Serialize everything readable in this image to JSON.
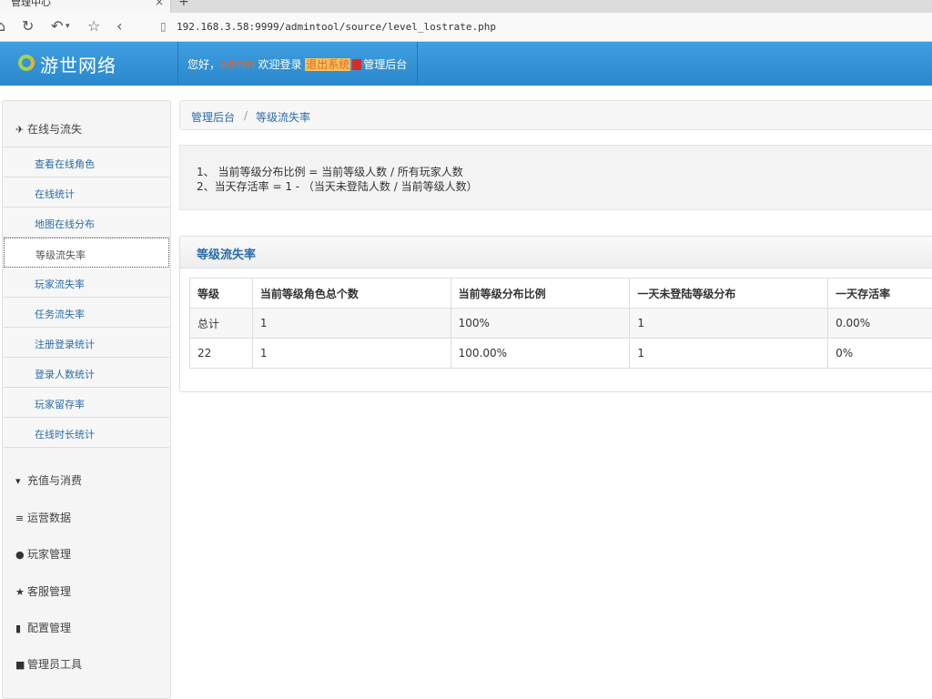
{
  "browser": {
    "tab_title": "管理中心",
    "tab_close": "×",
    "new_tab": "+",
    "url": "192.168.3.58:9999/admintool/source/level_lostrate.php"
  },
  "header": {
    "logo_text": "游世网络",
    "greeting_prefix": "您好，",
    "user": "admin",
    "welcome": " 欢迎登录 ",
    "logout": "退出系统",
    "admin_link": "管理后台"
  },
  "sidebar": {
    "groups": [
      {
        "label": "在线与流失",
        "icon": "plane-icon"
      },
      {
        "label": "充值与消费",
        "icon": "cart-icon"
      },
      {
        "label": "运营数据",
        "icon": "list-icon"
      },
      {
        "label": "玩家管理",
        "icon": "user-icon"
      },
      {
        "label": "客服管理",
        "icon": "star-icon"
      },
      {
        "label": "配置管理",
        "icon": "book-icon"
      },
      {
        "label": "管理员工具",
        "icon": "lock-icon"
      }
    ],
    "items": [
      {
        "label": "查看在线角色"
      },
      {
        "label": "在线统计"
      },
      {
        "label": "地图在线分布"
      },
      {
        "label": "等级流失率"
      },
      {
        "label": "玩家流失率"
      },
      {
        "label": "任务流失率"
      },
      {
        "label": "注册登录统计"
      },
      {
        "label": "登录人数统计"
      },
      {
        "label": "玩家留存率"
      },
      {
        "label": "在线时长统计"
      }
    ]
  },
  "breadcrumb": {
    "root": "管理后台",
    "sep": "/",
    "current": "等级流失率"
  },
  "info": {
    "line1": "1、 当前等级分布比例 = 当前等级人数 / 所有玩家人数",
    "line2": "2、当天存活率 = 1 - （当天未登陆人数 / 当前等级人数）"
  },
  "panel": {
    "title": "等级流失率"
  },
  "table": {
    "headers": [
      "等级",
      "当前等级角色总个数",
      "当前等级分布比例",
      "一天未登陆等级分布",
      "一天存活率"
    ],
    "rows": [
      [
        "总计",
        "1",
        "100%",
        "1",
        "0.00%"
      ],
      [
        "22",
        "1",
        "100.00%",
        "1",
        "0%"
      ]
    ]
  }
}
